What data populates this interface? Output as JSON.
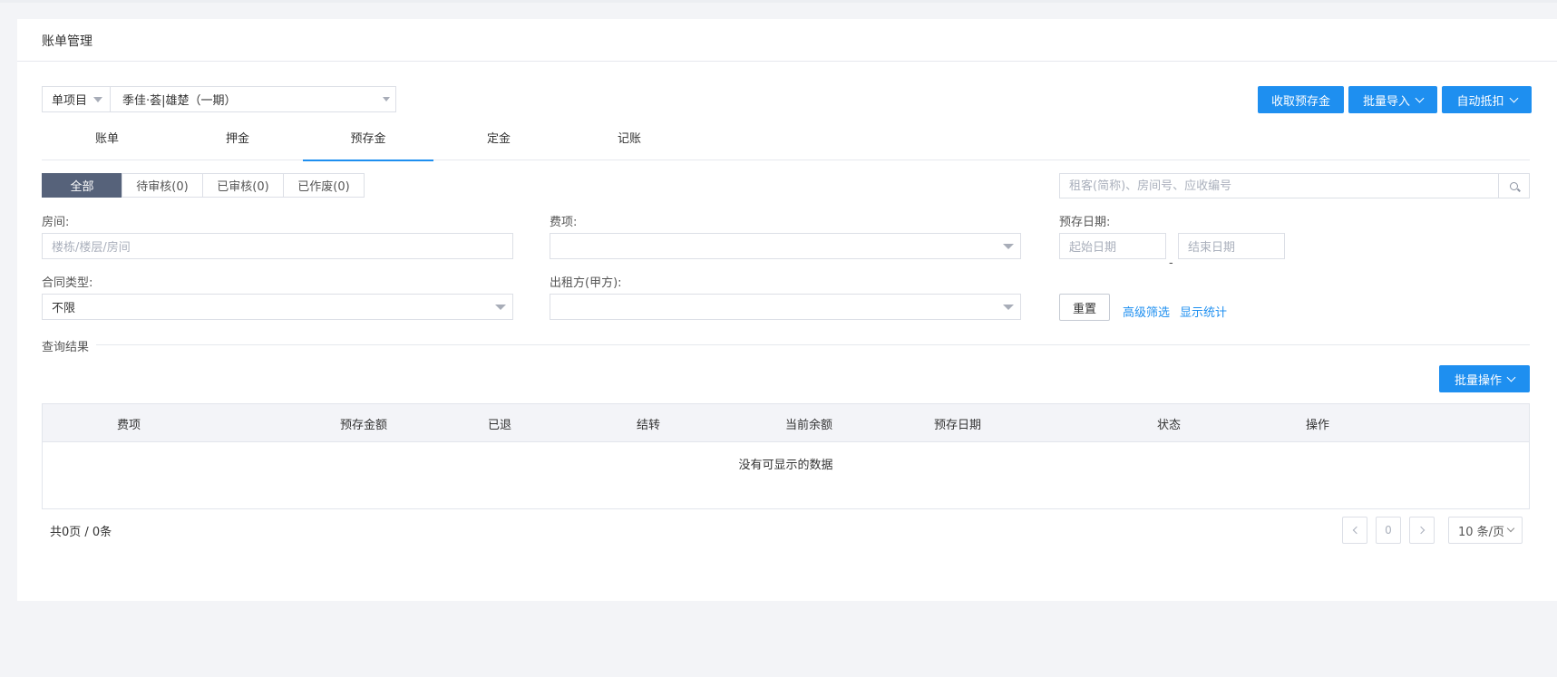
{
  "page": {
    "title": "账单管理"
  },
  "project": {
    "type": "单项目",
    "name": "季佳·荟|雄楚（一期）"
  },
  "actions": {
    "collect_deposit": "收取预存金",
    "batch_import": "批量导入",
    "auto_deduct": "自动抵扣",
    "batch_ops": "批量操作"
  },
  "tabs": [
    {
      "label": "账单"
    },
    {
      "label": "押金"
    },
    {
      "label": "预存金",
      "active": true
    },
    {
      "label": "定金"
    },
    {
      "label": "记账"
    }
  ],
  "status_filters": [
    {
      "label": "全部",
      "active": true
    },
    {
      "label": "待审核(0)"
    },
    {
      "label": "已审核(0)"
    },
    {
      "label": "已作废(0)"
    }
  ],
  "search": {
    "placeholder": "租客(简称)、房间号、应收编号"
  },
  "filters": {
    "room": {
      "label": "房间:",
      "placeholder": "楼栋/楼层/房间"
    },
    "fee": {
      "label": "费项:",
      "value": ""
    },
    "deposit_date": {
      "label": "预存日期:",
      "start_placeholder": "起始日期",
      "end_placeholder": "结束日期",
      "separator": "-"
    },
    "contract_type": {
      "label": "合同类型:",
      "value": "不限"
    },
    "lessor": {
      "label": "出租方(甲方):",
      "value": ""
    }
  },
  "buttons": {
    "reset": "重置",
    "advanced": "高级筛选",
    "stats": "显示统计"
  },
  "results": {
    "title": "查询结果",
    "columns": [
      "费项",
      "预存金额",
      "已退",
      "结转",
      "当前余额",
      "预存日期",
      "状态",
      "操作"
    ],
    "empty_text": "没有可显示的数据"
  },
  "pagination": {
    "summary": "共0页 / 0条",
    "current_page": "0",
    "page_size": "10 条/页"
  },
  "colors": {
    "accent": "#1e8ff0",
    "active_filter": "#56627a",
    "background": "#f3f4f7"
  }
}
